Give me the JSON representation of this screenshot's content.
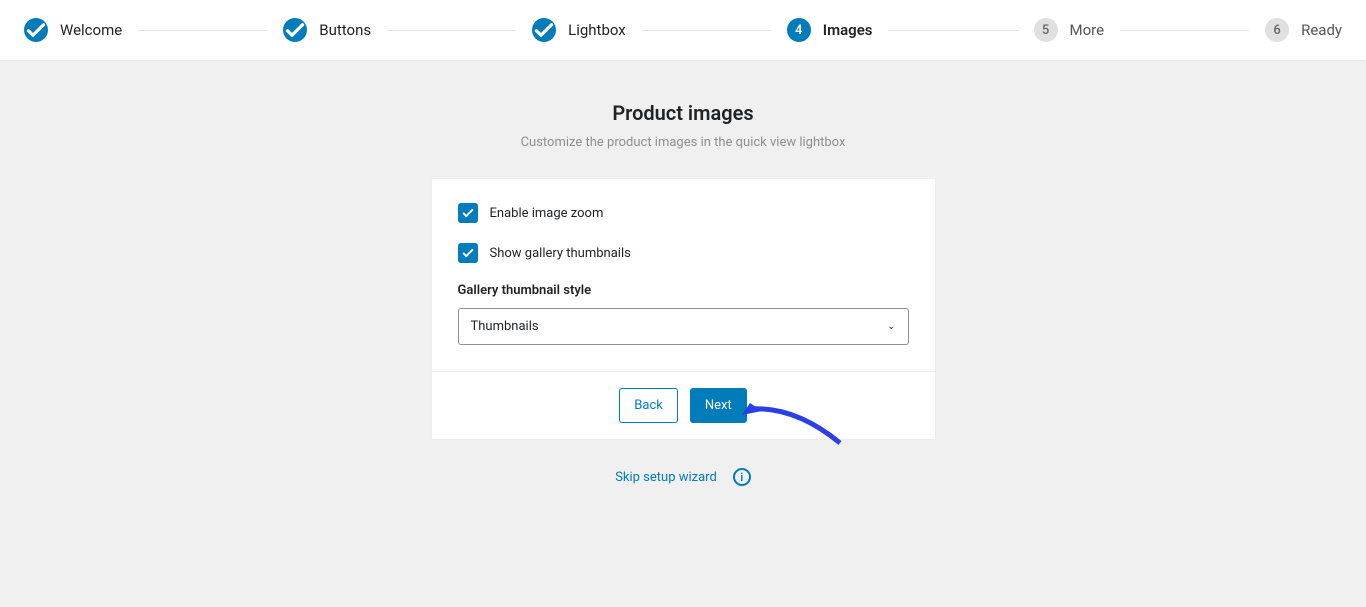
{
  "stepper": {
    "steps": [
      {
        "label": "Welcome",
        "state": "done",
        "badge": "✓"
      },
      {
        "label": "Buttons",
        "state": "done",
        "badge": "✓"
      },
      {
        "label": "Lightbox",
        "state": "done",
        "badge": "✓"
      },
      {
        "label": "Images",
        "state": "active",
        "badge": "4"
      },
      {
        "label": "More",
        "state": "future",
        "badge": "5"
      },
      {
        "label": "Ready",
        "state": "future",
        "badge": "6"
      }
    ]
  },
  "header": {
    "title": "Product images",
    "subtitle": "Customize the product images in the quick view lightbox"
  },
  "form": {
    "checkboxes": [
      {
        "label": "Enable image zoom",
        "checked": true
      },
      {
        "label": "Show gallery thumbnails",
        "checked": true
      }
    ],
    "thumbnail_style": {
      "label": "Gallery thumbnail style",
      "selected": "Thumbnails"
    }
  },
  "footer": {
    "back_label": "Back",
    "next_label": "Next"
  },
  "skip": {
    "label": "Skip setup wizard"
  }
}
